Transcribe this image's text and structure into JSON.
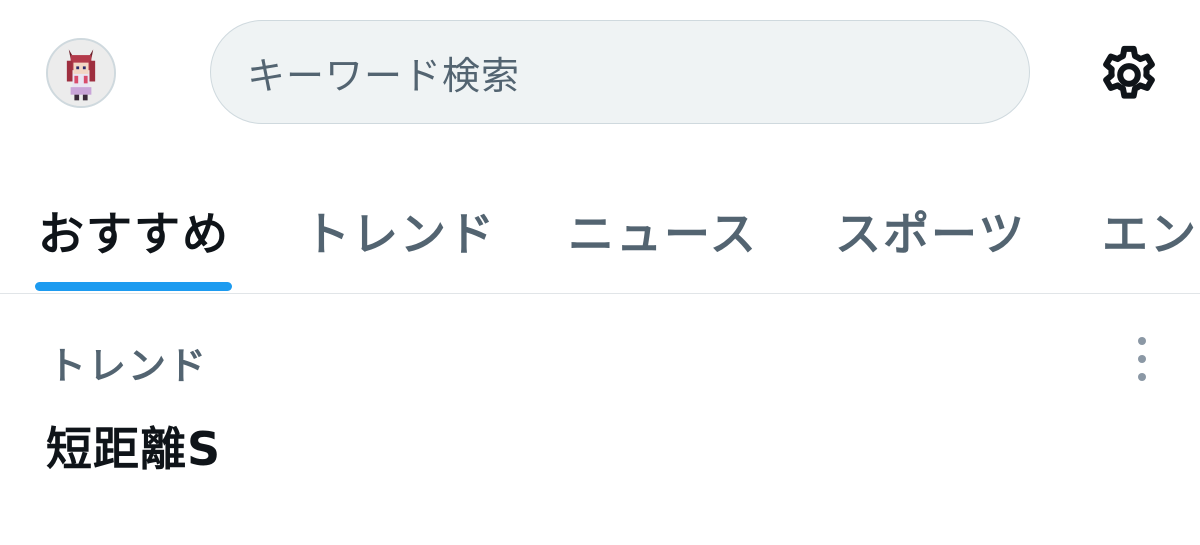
{
  "header": {
    "search_placeholder": "キーワード検索"
  },
  "tabs": [
    {
      "label": "おすすめ",
      "active": true
    },
    {
      "label": "トレンド",
      "active": false
    },
    {
      "label": "ニュース",
      "active": false
    },
    {
      "label": "スポーツ",
      "active": false
    },
    {
      "label": "エン",
      "active": false
    }
  ],
  "trend": {
    "category": "トレンド",
    "title": "短距離S"
  },
  "colors": {
    "accent": "#1d9bf0",
    "text_primary": "#0f1419",
    "text_secondary": "#536471",
    "search_bg": "#eff3f4"
  },
  "icons": {
    "avatar": "avatar-icon",
    "settings": "gear-icon",
    "more": "more-vertical-icon"
  }
}
